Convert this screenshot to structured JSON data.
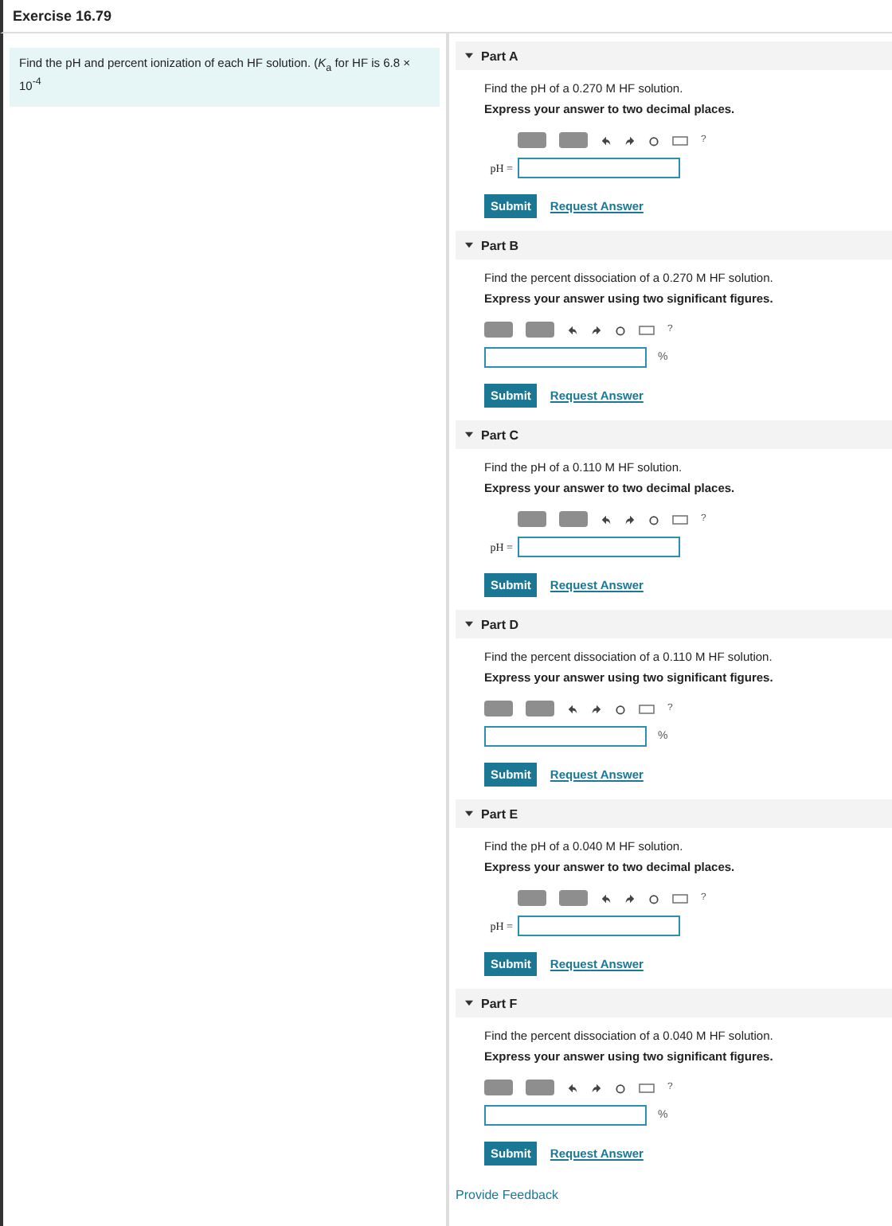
{
  "exercise_title": "Exercise 16.79",
  "problem": "Find the pH and percent ionization of each HF solution. (*K*$_{a}$ for HF is 6.8 × 10$^{-4}$",
  "parts": [
    {
      "title": "Part A",
      "expanded": true,
      "kind": "label",
      "question": "Find the pH of a 0.270 M HF solution.",
      "instruction": "Express your answer to two decimal places.",
      "label": "pH =",
      "submit": "Submit",
      "request": "Request Answer"
    },
    {
      "title": "Part B",
      "expanded": true,
      "kind": "unit",
      "question": "Find the percent dissociation of a 0.270 M HF solution.",
      "instruction": "Express your answer using two significant figures.",
      "unit": "%",
      "submit": "Submit",
      "request": "Request Answer"
    },
    {
      "title": "Part C",
      "expanded": true,
      "kind": "label",
      "question": "Find the pH of a 0.110 M HF solution.",
      "instruction": "Express your answer to two decimal places.",
      "label": "pH =",
      "submit": "Submit",
      "request": "Request Answer"
    },
    {
      "title": "Part D",
      "expanded": true,
      "kind": "unit",
      "question": "Find the percent dissociation of a 0.110 M HF solution.",
      "instruction": "Express your answer using two significant figures.",
      "unit": "%",
      "submit": "Submit",
      "request": "Request Answer"
    },
    {
      "title": "Part E",
      "expanded": true,
      "kind": "label",
      "question": "Find the pH of a 0.040 M HF solution.",
      "instruction": "Express your answer to two decimal places.",
      "label": "pH =",
      "submit": "Submit",
      "request": "Request Answer"
    },
    {
      "title": "Part F",
      "expanded": true,
      "kind": "unit",
      "question": "Find the percent dissociation of a 0.040 M HF solution.",
      "instruction": "Express your answer using two significant figures.",
      "unit": "%",
      "submit": "Submit",
      "request": "Request Answer"
    }
  ],
  "toolbar_help": "?",
  "feedback_link": "Provide Feedback"
}
